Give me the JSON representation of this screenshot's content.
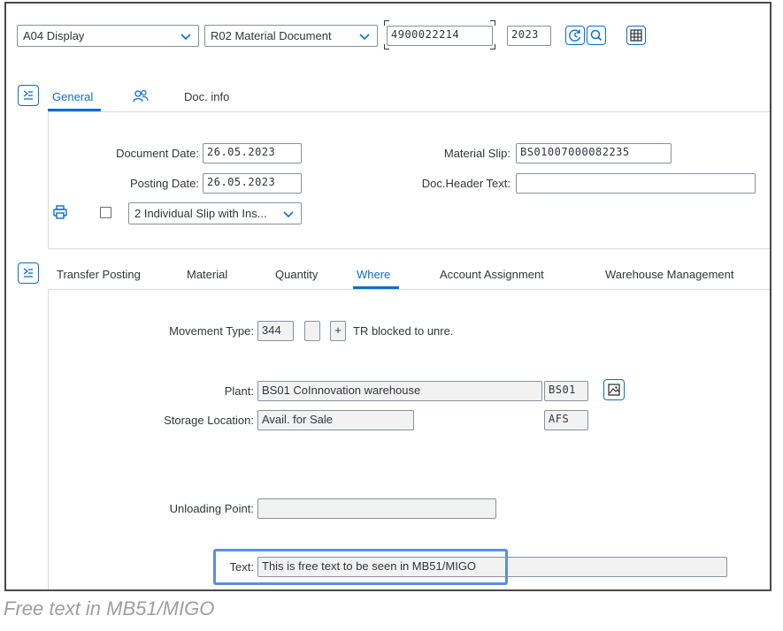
{
  "toolbar": {
    "action": "A04 Display",
    "ref_doc": "R02 Material Document",
    "doc_number": "4900022214",
    "year": "2023"
  },
  "header_tabs": {
    "general": "General",
    "doc_info": "Doc. info"
  },
  "header": {
    "document_date_label": "Document Date:",
    "document_date": "26.05.2023",
    "posting_date_label": "Posting Date:",
    "posting_date": "26.05.2023",
    "material_slip_label": "Material Slip:",
    "material_slip": "BS01007000082235",
    "doc_header_text_label": "Doc.Header Text:",
    "doc_header_text": "",
    "print_version": "2 Individual Slip with Ins..."
  },
  "item_tabs": {
    "transfer_posting": "Transfer Posting",
    "material": "Material",
    "quantity": "Quantity",
    "where": "Where",
    "account_assignment": "Account Assignment",
    "warehouse_management": "Warehouse Management"
  },
  "where": {
    "movement_type_label": "Movement Type:",
    "movement_type": "344",
    "movement_indicator": "",
    "sign": "+",
    "movement_text": "TR blocked to unre.",
    "plant_label": "Plant:",
    "plant_name": "BS01 CoInnovation warehouse",
    "plant_code": "BS01",
    "storage_location_label": "Storage Location:",
    "storage_location_name": "Avail. for Sale",
    "storage_location_code": "AFS",
    "unloading_point_label": "Unloading Point:",
    "unloading_point": "",
    "text_label": "Text:",
    "text": "This is free text to be seen in MB51/MIGO"
  },
  "caption": "Free text in MB51/MIGO",
  "colors": {
    "accent": "#0a6ed1",
    "highlight": "#5b8fe0"
  }
}
